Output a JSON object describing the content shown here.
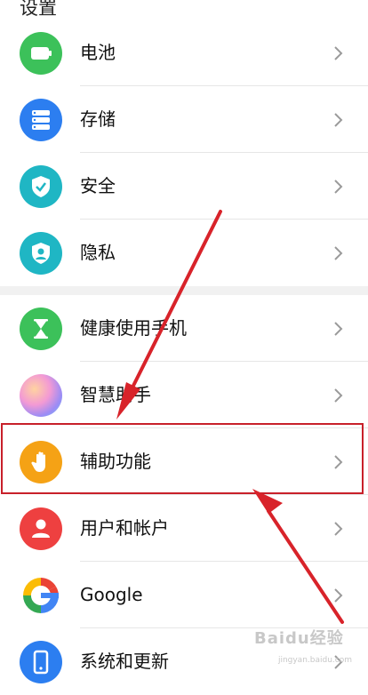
{
  "header": {
    "title": "设置"
  },
  "items": [
    {
      "label": "电池",
      "icon": "battery-icon",
      "color": "#3cc15a"
    },
    {
      "label": "存储",
      "icon": "storage-icon",
      "color": "#2c7ef0"
    },
    {
      "label": "安全",
      "icon": "shield-check-icon",
      "color": "#1fb6c4"
    },
    {
      "label": "隐私",
      "icon": "privacy-shield-icon",
      "color": "#1fb6c4"
    },
    {
      "label": "健康使用手机",
      "icon": "hourglass-icon",
      "color": "#3cc15a"
    },
    {
      "label": "智慧助手",
      "icon": "assistant-orb-icon",
      "color": "#c78ef5"
    },
    {
      "label": "辅助功能",
      "icon": "hand-icon",
      "color": "#f5a215"
    },
    {
      "label": "用户和帐户",
      "icon": "user-icon",
      "color": "#ee4040"
    },
    {
      "label": "Google",
      "icon": "google-icon",
      "color": "#4285f4"
    },
    {
      "label": "系统和更新",
      "icon": "system-update-icon",
      "color": "#2c7ef0"
    }
  ],
  "annotation": {
    "highlight_color": "#c8202a"
  },
  "watermark": {
    "text": "Baidu经验",
    "sub": "jingyan.baidu.com"
  }
}
